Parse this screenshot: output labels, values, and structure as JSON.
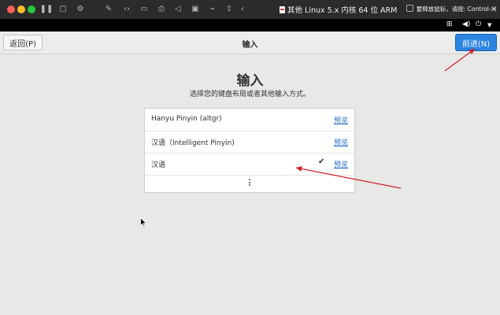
{
  "vm_window": {
    "title": "其他 Linux 5.x 内核 64 位 ARM",
    "hint": "要释放鼠标，请按: Control-⌘"
  },
  "header": {
    "back_label": "返回(P)",
    "title": "输入",
    "next_label": "前进(N)"
  },
  "main": {
    "title": "输入",
    "subtitle": "选择您的键盘布局或者其他输入方式。"
  },
  "input_sources": [
    {
      "label": "Hanyu Pinyin (altgr)",
      "preview": "预览",
      "selected": false
    },
    {
      "label": "汉语（Intelligent Pinyin)",
      "preview": "预览",
      "selected": false
    },
    {
      "label": "汉语",
      "preview": "预览",
      "selected": true
    }
  ],
  "colors": {
    "accent": "#2a84e0",
    "annotation_arrow": "#d0202a",
    "link": "#2a6fc0"
  }
}
